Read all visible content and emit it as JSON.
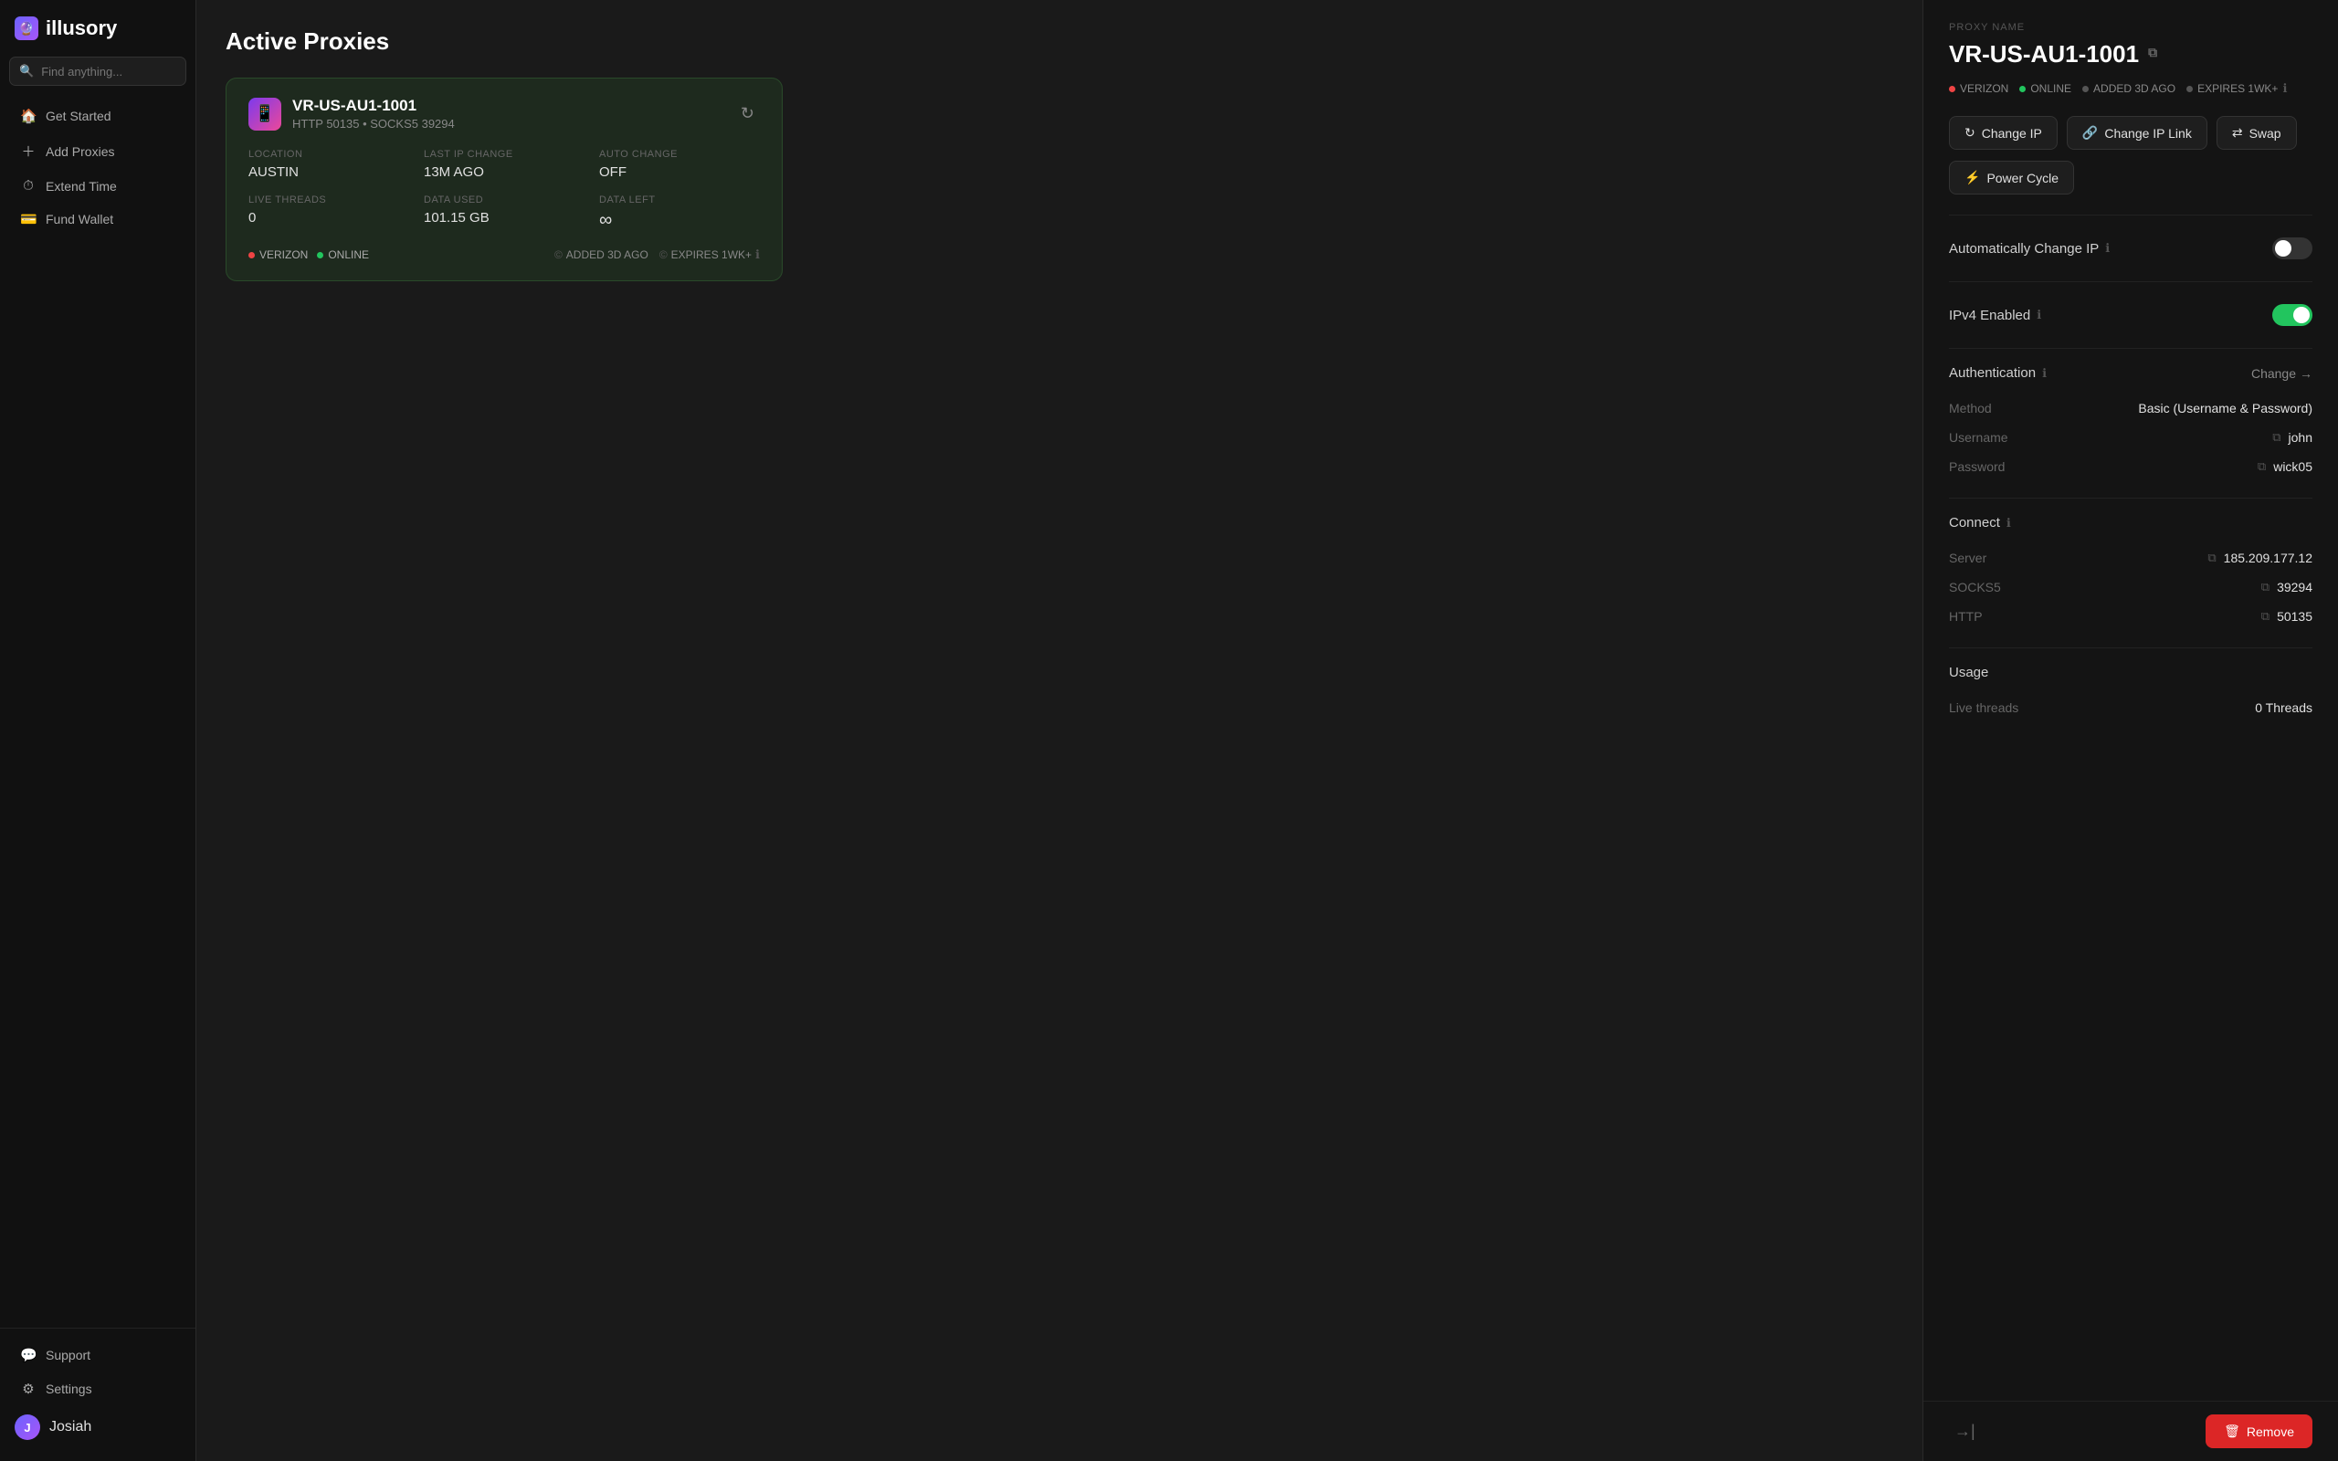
{
  "app": {
    "name": "illusory",
    "logo_emoji": "🔮"
  },
  "search": {
    "placeholder": "Find anything..."
  },
  "sidebar": {
    "items": [
      {
        "id": "get-started",
        "label": "Get Started",
        "icon": "🏠"
      },
      {
        "id": "add-proxies",
        "label": "Add Proxies",
        "icon": "+"
      },
      {
        "id": "extend-time",
        "label": "Extend Time",
        "icon": "⏱"
      },
      {
        "id": "fund-wallet",
        "label": "Fund Wallet",
        "icon": "💳"
      }
    ],
    "bottom_items": [
      {
        "id": "support",
        "label": "Support",
        "icon": "💬"
      },
      {
        "id": "settings",
        "label": "Settings",
        "icon": "⚙"
      }
    ],
    "user": {
      "name": "Josiah",
      "initial": "J"
    }
  },
  "main": {
    "title": "Active Proxies",
    "proxy_card": {
      "name": "VR-US-AU1-1001",
      "subtitle": "HTTP 50135 • SOCKS5 39294",
      "location_label": "LOCATION",
      "location_value": "AUSTIN",
      "last_ip_label": "LAST IP CHANGE",
      "last_ip_value": "13M AGO",
      "auto_change_label": "AUTO CHANGE",
      "auto_change_value": "OFF",
      "live_threads_label": "LIVE THREADS",
      "live_threads_value": "0",
      "data_used_label": "DATA USED",
      "data_used_value": "101.15 GB",
      "data_left_label": "DATA LEFT",
      "data_left_value": "∞",
      "carrier": "VERIZON",
      "status": "ONLINE",
      "added": "ADDED 3D AGO",
      "expires": "EXPIRES 1WK+"
    }
  },
  "panel": {
    "section_label": "PROXY NAME",
    "proxy_name": "VR-US-AU1-1001",
    "badges": {
      "carrier": "VERIZON",
      "status": "ONLINE",
      "added": "ADDED 3D AGO",
      "expires": "EXPIRES 1WK+"
    },
    "buttons": {
      "change_ip": "Change IP",
      "change_ip_link": "Change IP Link",
      "swap": "Swap",
      "power_cycle": "Power Cycle"
    },
    "toggles": {
      "auto_change_ip_label": "Automatically Change IP",
      "auto_change_ip_on": false,
      "ipv4_label": "IPv4 Enabled",
      "ipv4_on": true
    },
    "authentication": {
      "title": "Authentication",
      "change_label": "Change",
      "method_label": "Method",
      "method_value": "Basic (Username & Password)",
      "username_label": "Username",
      "username_value": "john",
      "password_label": "Password",
      "password_value": "wick05"
    },
    "connect": {
      "title": "Connect",
      "server_label": "Server",
      "server_value": "185.209.177.12",
      "socks5_label": "SOCKS5",
      "socks5_value": "39294",
      "http_label": "HTTP",
      "http_value": "50135"
    },
    "usage": {
      "title": "Usage",
      "live_threads_label": "Live threads",
      "live_threads_value": "0 Threads"
    },
    "footer": {
      "remove_label": "Remove"
    }
  },
  "colors": {
    "green": "#22c55e",
    "red": "#ef4444",
    "red_btn": "#dc2626"
  }
}
